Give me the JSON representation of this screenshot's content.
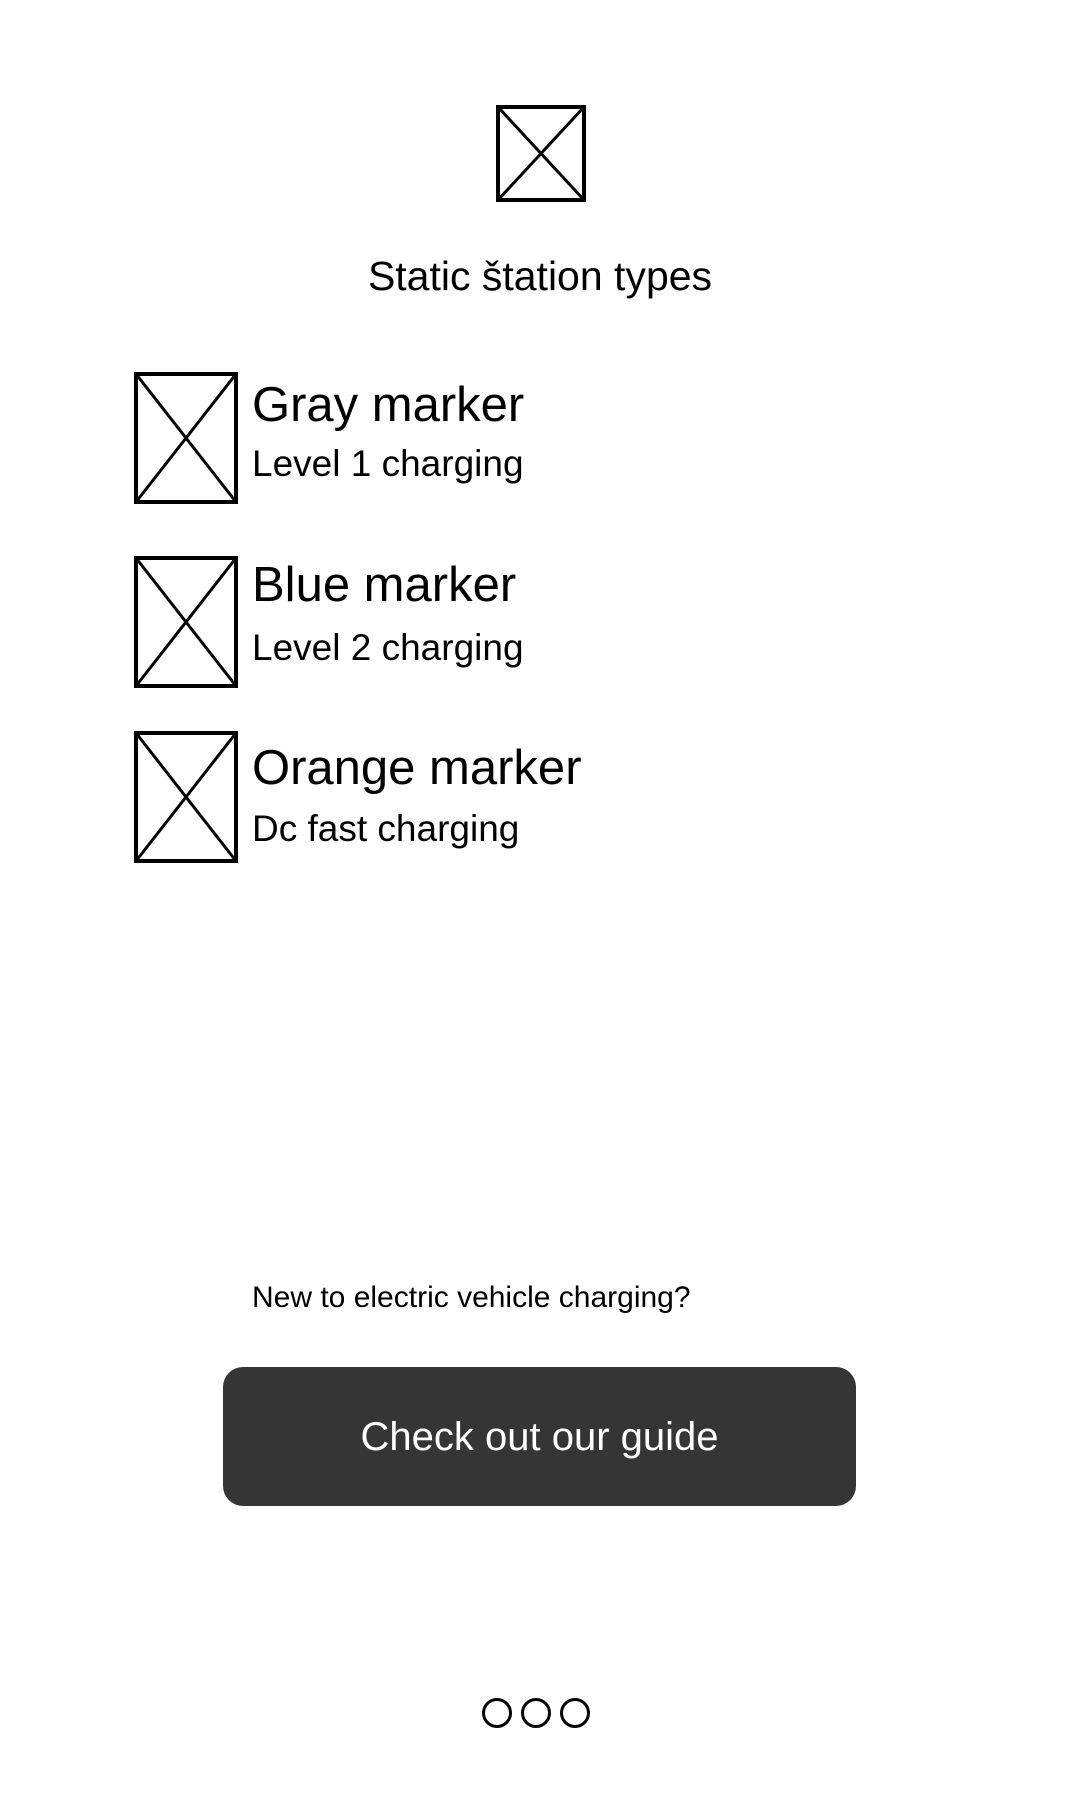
{
  "header": {
    "title": "Static štation types",
    "image_icon": "image-placeholder-icon"
  },
  "markers": [
    {
      "title": "Gray marker",
      "subtitle": "Level 1 charging",
      "icon": "image-placeholder-icon"
    },
    {
      "title": "Blue marker",
      "subtitle": "Level 2 charging",
      "icon": "image-placeholder-icon"
    },
    {
      "title": "Orange marker",
      "subtitle": "Dc fast charging",
      "icon": "image-placeholder-icon"
    }
  ],
  "footer": {
    "prompt": "New to electric vehicle charging?",
    "guide_button_label": "Check out our guide",
    "button_color": "#353535"
  },
  "pagination": {
    "dots": 3
  }
}
